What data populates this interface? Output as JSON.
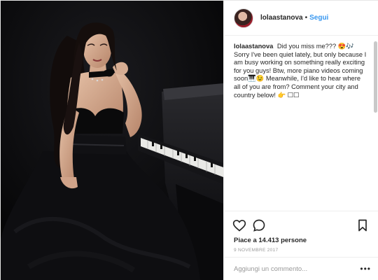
{
  "post": {
    "username": "lolaastanova",
    "separator": "•",
    "follow_label": "Segui",
    "caption_user": "lolaastanova",
    "caption_text": "Did you miss me??? 😍🎶 Sorry I've been quiet lately, but only because I am busy working on something really exciting for you guys! Btw, more piano videos coming soon🎹😉 Meanwhile, I'd like to hear where all of you are from? Comment your city and country below! 👉 ☐☐",
    "likes_text": "Piace a 14.413 persone",
    "date_text": "9 NOVEMBRE 2017",
    "comment_placeholder": "Aggiungi un commento...",
    "more_label": "•••"
  },
  "icons": {
    "like": "heart-icon",
    "comment": "comment-bubble-icon",
    "save": "bookmark-icon",
    "more": "more-options-icon"
  },
  "colors": {
    "accent": "#3897f0",
    "text": "#262626",
    "muted": "#999999",
    "photo_bg": "#0b0b0d"
  }
}
